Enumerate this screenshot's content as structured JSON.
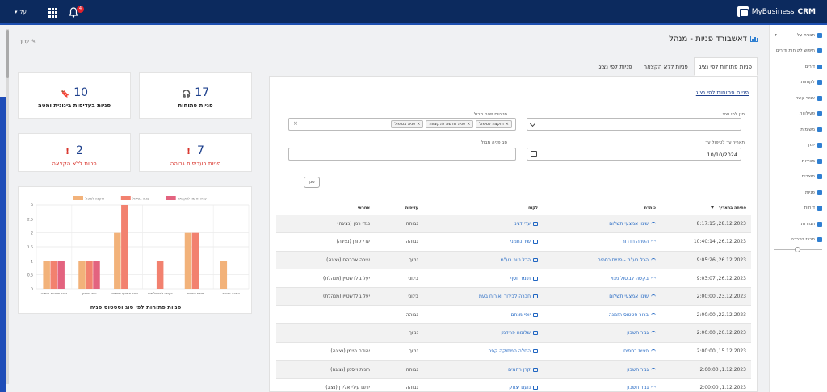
{
  "topbar": {
    "brand_name": "MyBusiness",
    "brand_suffix": "CRM",
    "user_label": "יעל",
    "notification_count": "4"
  },
  "sidebar": {
    "items": [
      {
        "label": "תבנית על",
        "icon": "chart-icon"
      },
      {
        "label": "חיפוש לקוחות ודירים",
        "icon": "search-icon"
      },
      {
        "label": "דירים",
        "icon": "people-icon"
      },
      {
        "label": "לקוחות",
        "icon": "users-icon"
      },
      {
        "label": "אנשי קשר",
        "icon": "contact-icon"
      },
      {
        "label": "פעילויות",
        "icon": "activity-icon"
      },
      {
        "label": "משימות",
        "icon": "tasks-icon"
      },
      {
        "label": "יומן",
        "icon": "calendar-icon"
      },
      {
        "label": "מכירות",
        "icon": "sales-icon"
      },
      {
        "label": "חוצרים",
        "icon": "products-icon"
      },
      {
        "label": "פניות",
        "icon": "headset-icon"
      },
      {
        "label": "דוחות",
        "icon": "report-icon"
      },
      {
        "label": "הגדרות",
        "icon": "gear-icon"
      },
      {
        "label": "מרכז הדרכה",
        "icon": "help-icon"
      }
    ]
  },
  "page": {
    "title": "דאשבורד פניות - מנהל",
    "edit_label": "ערוך"
  },
  "tabs": [
    {
      "label": "פניות פתוחות לפי נציג",
      "active": true
    },
    {
      "label": "פניות ללא הקצאה",
      "active": false
    },
    {
      "label": "פניות לפי נציג",
      "active": false
    }
  ],
  "panel": {
    "subtitle": "פניות פתוחות לפי נציג"
  },
  "filters": {
    "agent_label": "סנן לפי נציג",
    "status_label": "סטטוס פניה מבול",
    "status_chips": [
      "הוקצה לטיפול",
      "פניה חדשה להקצאה",
      "פניה בטיפול"
    ],
    "date_label": "תאריך עד לטיפול עד",
    "date_value": "10/10/2024",
    "type_label": "סב פניה מבול",
    "search_button": "סנן"
  },
  "table": {
    "headers": [
      "פתיחה בתאריך",
      "כותרת",
      "לקוח",
      "עדיפות",
      "אחראי"
    ],
    "rows": [
      {
        "date": "28.12.2023, 8:17:15",
        "title": "שינוי אמצעי תשלום",
        "customer": "עדי דגיני",
        "priority": "גבוהה",
        "owner": "נגדי רמן (נציגה)"
      },
      {
        "date": "26.12.2023, 10:40:14",
        "title": "הסרה חדרור",
        "customer": "שיר נחמני",
        "priority": "גבוהה",
        "owner": "עדי קורן (נציגה)"
      },
      {
        "date": "26.12.2023, 9:05:26",
        "title": "הכל בע\"מ - פניית כספים",
        "customer": "הכל טוב בע\"מ",
        "priority": "נמוך",
        "owner": "שירה אברהם (נציגה)"
      },
      {
        "date": "26.12.2023, 9:03:07",
        "title": "בקשה לביטול מנוי",
        "customer": "תומר יוסף",
        "priority": "בינוני",
        "owner": "יעל גולדשטיין (מנהלת)"
      },
      {
        "date": "23.12.2023, 2:00:00",
        "title": "שינוי אמצעי תשלום",
        "customer": "חברה לבידור ואירוח בעמ",
        "priority": "בינוני",
        "owner": "יעל גולדשטיין (מנהלת)"
      },
      {
        "date": "22.12.2023, 2:00:00",
        "title": "ברור סטטוס הזמנה",
        "customer": "יוסי מנחם",
        "priority": "גבוהה",
        "owner": ""
      },
      {
        "date": "20.12.2023, 2:00:00",
        "title": "גמר חשבון",
        "customer": "שלומה פרידמן",
        "priority": "נמוך",
        "owner": ""
      },
      {
        "date": "15.12.2023, 2:00:00",
        "title": "פניית כספים",
        "customer": "החלה המתוקה קפה",
        "priority": "נמוך",
        "owner": "יהודה היימן (נציגה)"
      },
      {
        "date": "1.12.2023, 2:00:00",
        "title": "גמר חשבון",
        "customer": "קרן רחמים",
        "priority": "גבוהה",
        "owner": "רונית וייסמן (נציגה)"
      },
      {
        "date": "1.12.2023, 2:00:00",
        "title": "גמר חשבון",
        "customer": "נועם יצחק",
        "priority": "גבוהה",
        "owner": "יותם עילי אלירן (נציג)"
      }
    ]
  },
  "cards": [
    {
      "value": "17",
      "label": "פניות פתוחות",
      "icon": "headset-icon",
      "red": false
    },
    {
      "value": "10",
      "label": "פניות בעדיפות בינונית ומטה",
      "icon": "bookmark-icon",
      "red": false
    },
    {
      "value": "7",
      "label": "פניות בעדיפות גבוהה",
      "icon": "alert-icon",
      "red": true
    },
    {
      "value": "2",
      "label": "פניות ללא הקצאה",
      "icon": "alert-icon",
      "red": true
    }
  ],
  "colors": {
    "topbar": "#0c2a5e",
    "accent": "#1f65c2",
    "series1": "#f2b27a",
    "series2": "#f2816f",
    "series3": "#e3637f",
    "alert": "#d8322a"
  },
  "chart_data": {
    "type": "bar",
    "title": "פניות פתוחות לפי סוג וסטטוס פניה",
    "categories": [
      "ברור סטטוס הזמנה",
      "גמר חשבון",
      "שינוי אמצעי תשלום",
      "בקשה לביטול מנוי",
      "פניית כספים",
      "הסרה חדרור"
    ],
    "series": [
      {
        "name": "הוקצה לטיפול",
        "values": [
          1,
          1,
          2,
          0,
          2,
          1
        ]
      },
      {
        "name": "פניה בטיפול",
        "values": [
          1,
          1,
          3,
          1,
          2,
          0
        ]
      },
      {
        "name": "פניה חדשה להקצאה",
        "values": [
          1,
          1,
          0,
          0,
          0,
          0
        ]
      }
    ],
    "ylim": [
      0,
      3
    ],
    "yticks": [
      "0",
      "0.5",
      "1",
      "1.5",
      "2",
      "2.5",
      "3"
    ],
    "legend": "top",
    "grid": true
  }
}
